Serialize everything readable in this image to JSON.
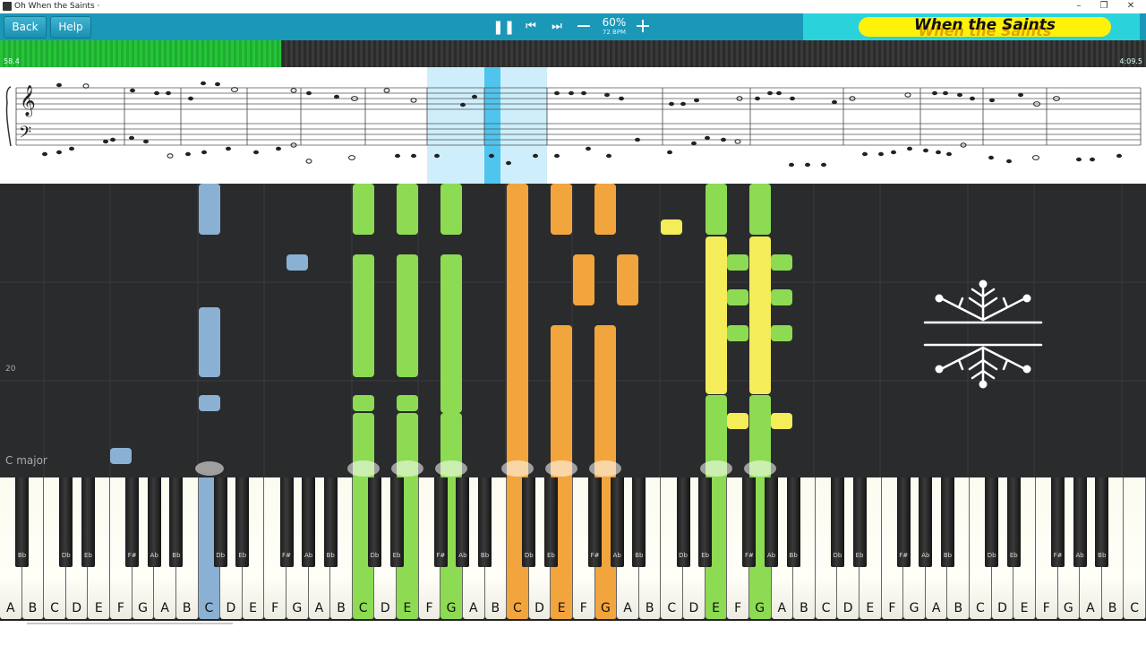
{
  "window": {
    "title": "Oh When the Saints",
    "dot": "·",
    "minimize": "–",
    "restore": "❐",
    "close": "✕"
  },
  "toolbar": {
    "back_label": "Back",
    "help_label": "Help",
    "pause_icon": "❚❚",
    "prev_icon": "⏮",
    "next_icon": "⏭",
    "minus_icon": "−",
    "plus_icon": "+",
    "tempo_percent": "60%",
    "tempo_bpm": "72 BPM"
  },
  "song": {
    "title": "When the Saints"
  },
  "progress": {
    "elapsed": "58.4",
    "total": "4:09.5",
    "fraction": 0.245
  },
  "roll": {
    "measure_label": "20",
    "key_signature": "C major"
  },
  "keyboard": {
    "white_keys": [
      "A",
      "B",
      "C",
      "D",
      "E",
      "F",
      "G",
      "A",
      "B",
      "C",
      "D",
      "E",
      "F",
      "G",
      "A",
      "B",
      "C",
      "D",
      "E",
      "F",
      "G",
      "A",
      "B",
      "C",
      "D",
      "E",
      "F",
      "G",
      "A",
      "B",
      "C",
      "D",
      "E",
      "F",
      "G",
      "A",
      "B",
      "C",
      "D",
      "E",
      "F",
      "G",
      "A",
      "B",
      "C",
      "D",
      "E",
      "F",
      "G",
      "A",
      "B",
      "C"
    ],
    "black_labels": [
      "Bb",
      "Db",
      "Eb",
      "F#",
      "Ab",
      "Bb"
    ],
    "active_white": [
      {
        "index": 9,
        "color": "#8ab1d4"
      },
      {
        "index": 16,
        "color": "#8ddb52"
      },
      {
        "index": 18,
        "color": "#8ddb52"
      },
      {
        "index": 20,
        "color": "#8ddb52"
      },
      {
        "index": 23,
        "color": "#f2a53d"
      },
      {
        "index": 25,
        "color": "#f2a53d"
      },
      {
        "index": 27,
        "color": "#f2a53d"
      },
      {
        "index": 32,
        "color": "#8ddb52"
      },
      {
        "index": 34,
        "color": "#8ddb52"
      }
    ]
  },
  "colors": {
    "accent": "#1b97b8",
    "left_hand": "#8ab1d4",
    "right_hand": "#8ddb52",
    "melody": "#f2a53d",
    "yellow": "#f5ec5a",
    "progress": "#27c43a",
    "banner": "#2ad3dc",
    "pill": "#fff20a"
  }
}
